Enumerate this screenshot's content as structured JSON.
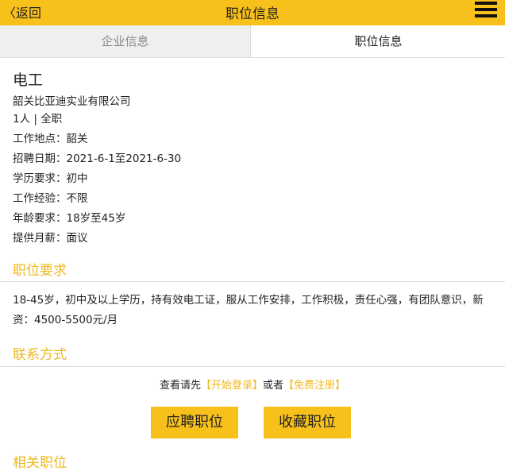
{
  "header": {
    "back_label": "〈返回",
    "title": "职位信息",
    "menu_icon": "hamburger-menu-icon"
  },
  "tabs": [
    {
      "label": "企业信息"
    },
    {
      "label": "职位信息"
    }
  ],
  "job": {
    "title": "电工",
    "company": "韶关比亚迪实业有限公司",
    "headcount": "1人 | 全职",
    "details": [
      "工作地点：韶关",
      "招聘日期：2021-6-1至2021-6-30",
      "学历要求：初中",
      "工作经验：不限",
      "年龄要求：18岁至45岁",
      "提供月薪：面议"
    ]
  },
  "requirements": {
    "title": "职位要求",
    "text": "18-45岁，初中及以上学历，持有效电工证，服从工作安排，工作积极，责任心强，有团队意识，新资：4500-5500元/月"
  },
  "contact": {
    "title": "联系方式",
    "prefix": "查看请先",
    "login_link": "【开始登录】",
    "middle": "或者",
    "register_link": "【免费注册】"
  },
  "actions": {
    "apply": "应聘职位",
    "favorite": "收藏职位"
  },
  "related": {
    "title": "相关职位"
  },
  "colors": {
    "accent": "#f8c01a",
    "section_text": "#f0b81d"
  }
}
